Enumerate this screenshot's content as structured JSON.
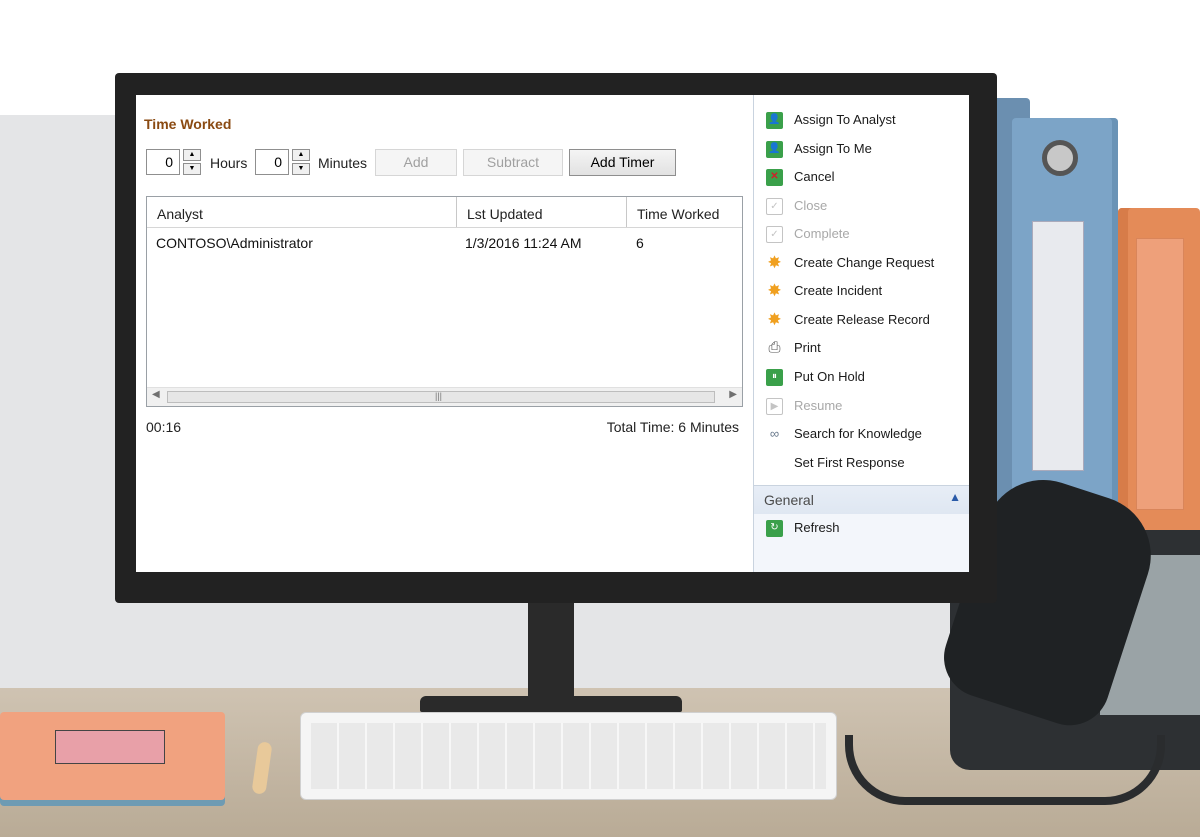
{
  "time_worked": {
    "title": "Time Worked",
    "hours_value": "0",
    "hours_label": "Hours",
    "minutes_value": "0",
    "minutes_label": "Minutes",
    "add_label": "Add",
    "subtract_label": "Subtract",
    "add_timer_label": "Add Timer",
    "grid": {
      "columns": [
        "Analyst",
        "Lst Updated",
        "Time Worked"
      ],
      "rows": [
        {
          "analyst": "CONTOSO\\Administrator",
          "updated": "1/3/2016 11:24 AM",
          "time": "6"
        }
      ]
    },
    "timer": "00:16",
    "total": "Total Time: 6 Minutes"
  },
  "tasks": {
    "items": [
      {
        "label": "Assign To Analyst",
        "icon": "assign-analyst-icon",
        "enabled": true
      },
      {
        "label": "Assign To Me",
        "icon": "assign-me-icon",
        "enabled": true
      },
      {
        "label": "Cancel",
        "icon": "cancel-icon",
        "enabled": true
      },
      {
        "label": "Close",
        "icon": "close-icon",
        "enabled": false
      },
      {
        "label": "Complete",
        "icon": "complete-icon",
        "enabled": false
      },
      {
        "label": "Create Change Request",
        "icon": "star-icon",
        "enabled": true
      },
      {
        "label": "Create Incident",
        "icon": "star-icon",
        "enabled": true
      },
      {
        "label": "Create Release Record",
        "icon": "star-icon",
        "enabled": true
      },
      {
        "label": "Print",
        "icon": "printer-icon",
        "enabled": true
      },
      {
        "label": "Put On Hold",
        "icon": "hold-icon",
        "enabled": true
      },
      {
        "label": "Resume",
        "icon": "resume-icon",
        "enabled": false
      },
      {
        "label": "Search for Knowledge",
        "icon": "link-icon",
        "enabled": true
      },
      {
        "label": "Set First Response",
        "icon": "",
        "enabled": true
      }
    ],
    "general_label": "General",
    "refresh_label": "Refresh"
  },
  "colors": {
    "title": "#8a4a12",
    "accent": "#2a5aa8",
    "task_green": "#3aa04a",
    "star": "#f0a020"
  }
}
